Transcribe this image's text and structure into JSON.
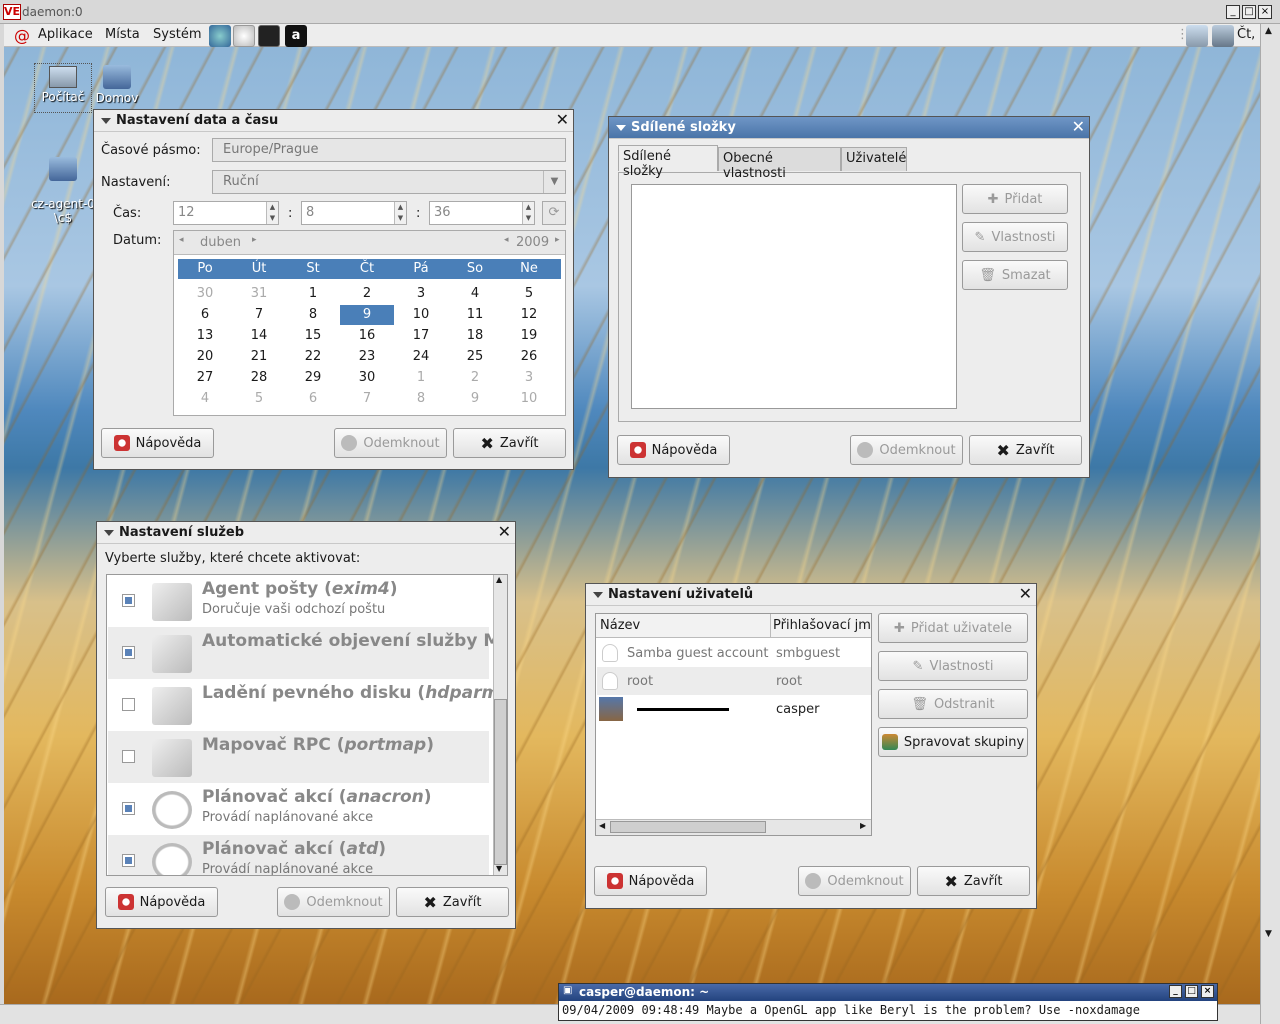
{
  "vnc": {
    "title": "daemon:0",
    "logo": "VE"
  },
  "panel": {
    "menus": [
      "Aplikace",
      "Místa",
      "Systém"
    ],
    "clock": "Čt,"
  },
  "desktop": {
    "icons": [
      {
        "label": "Počítač"
      },
      {
        "label": "Domov"
      },
      {
        "label": "cz-agent-0\n\\c$"
      }
    ]
  },
  "datetime": {
    "title": "Nastavení data a času",
    "timezone_label": "Časové pásmo:",
    "timezone_value": "Europe/Prague",
    "setting_label": "Nastavení:",
    "setting_value": "Ruční",
    "time_label": "Čas:",
    "hour": "12",
    "minute": "8",
    "second": "36",
    "date_label": "Datum:",
    "month": "duben",
    "year": "2009",
    "weekdays": [
      "Po",
      "Út",
      "St",
      "Čt",
      "Pá",
      "So",
      "Ne"
    ],
    "weeks": [
      [
        "30",
        "31",
        "1",
        "2",
        "3",
        "4",
        "5"
      ],
      [
        "6",
        "7",
        "8",
        "9",
        "10",
        "11",
        "12"
      ],
      [
        "13",
        "14",
        "15",
        "16",
        "17",
        "18",
        "19"
      ],
      [
        "20",
        "21",
        "22",
        "23",
        "24",
        "25",
        "26"
      ],
      [
        "27",
        "28",
        "29",
        "30",
        "1",
        "2",
        "3"
      ],
      [
        "4",
        "5",
        "6",
        "7",
        "8",
        "9",
        "10"
      ]
    ],
    "selected_day": "9",
    "help": "Nápověda",
    "unlock": "Odemknout",
    "close": "Zavřít"
  },
  "shares": {
    "title": "Sdílené složky",
    "tabs": [
      "Sdílené složky",
      "Obecné vlastnosti",
      "Uživatelé"
    ],
    "add": "Přidat",
    "props": "Vlastnosti",
    "delete": "Smazat",
    "help": "Nápověda",
    "unlock": "Odemknout",
    "close": "Zavřít"
  },
  "services": {
    "title": "Nastavení služeb",
    "prompt": "Vyberte služby, které chcete aktivovat:",
    "items": [
      {
        "name": "Agent pošty",
        "code": "exim4",
        "desc": "Doručuje vaši odchozí poštu",
        "checked": true
      },
      {
        "name": "Automatické objevení služby Mul",
        "code": "",
        "desc": "",
        "checked": true
      },
      {
        "name": "Ladění pevného disku",
        "code": "hdparm",
        "desc": "",
        "checked": false
      },
      {
        "name": "Mapovač RPC",
        "code": "portmap",
        "desc": "",
        "checked": false
      },
      {
        "name": "Plánovač akcí",
        "code": "anacron",
        "desc": "Provádí naplánované akce",
        "checked": true
      },
      {
        "name": "Plánovač akcí",
        "code": "atd",
        "desc": "Provádí naplánované akce",
        "checked": true
      }
    ],
    "help": "Nápověda",
    "unlock": "Odemknout",
    "close": "Zavřít"
  },
  "users": {
    "title": "Nastavení uživatelů",
    "col_name": "Název",
    "col_login": "Přihlašovací jme",
    "rows": [
      {
        "name": "Samba guest account",
        "login": "smbguest"
      },
      {
        "name": "root",
        "login": "root"
      },
      {
        "name": "",
        "login": "casper"
      }
    ],
    "add": "Přidat uživatele",
    "props": "Vlastnosti",
    "remove": "Odstranit",
    "groups": "Spravovat skupiny",
    "help": "Nápověda",
    "unlock": "Odemknout",
    "close": "Zavřít"
  },
  "terminal": {
    "title": "casper@daemon: ~",
    "line": "09/04/2009 09:48:49 Maybe a OpenGL app like Beryl is the problem? Use -noxdamage"
  }
}
